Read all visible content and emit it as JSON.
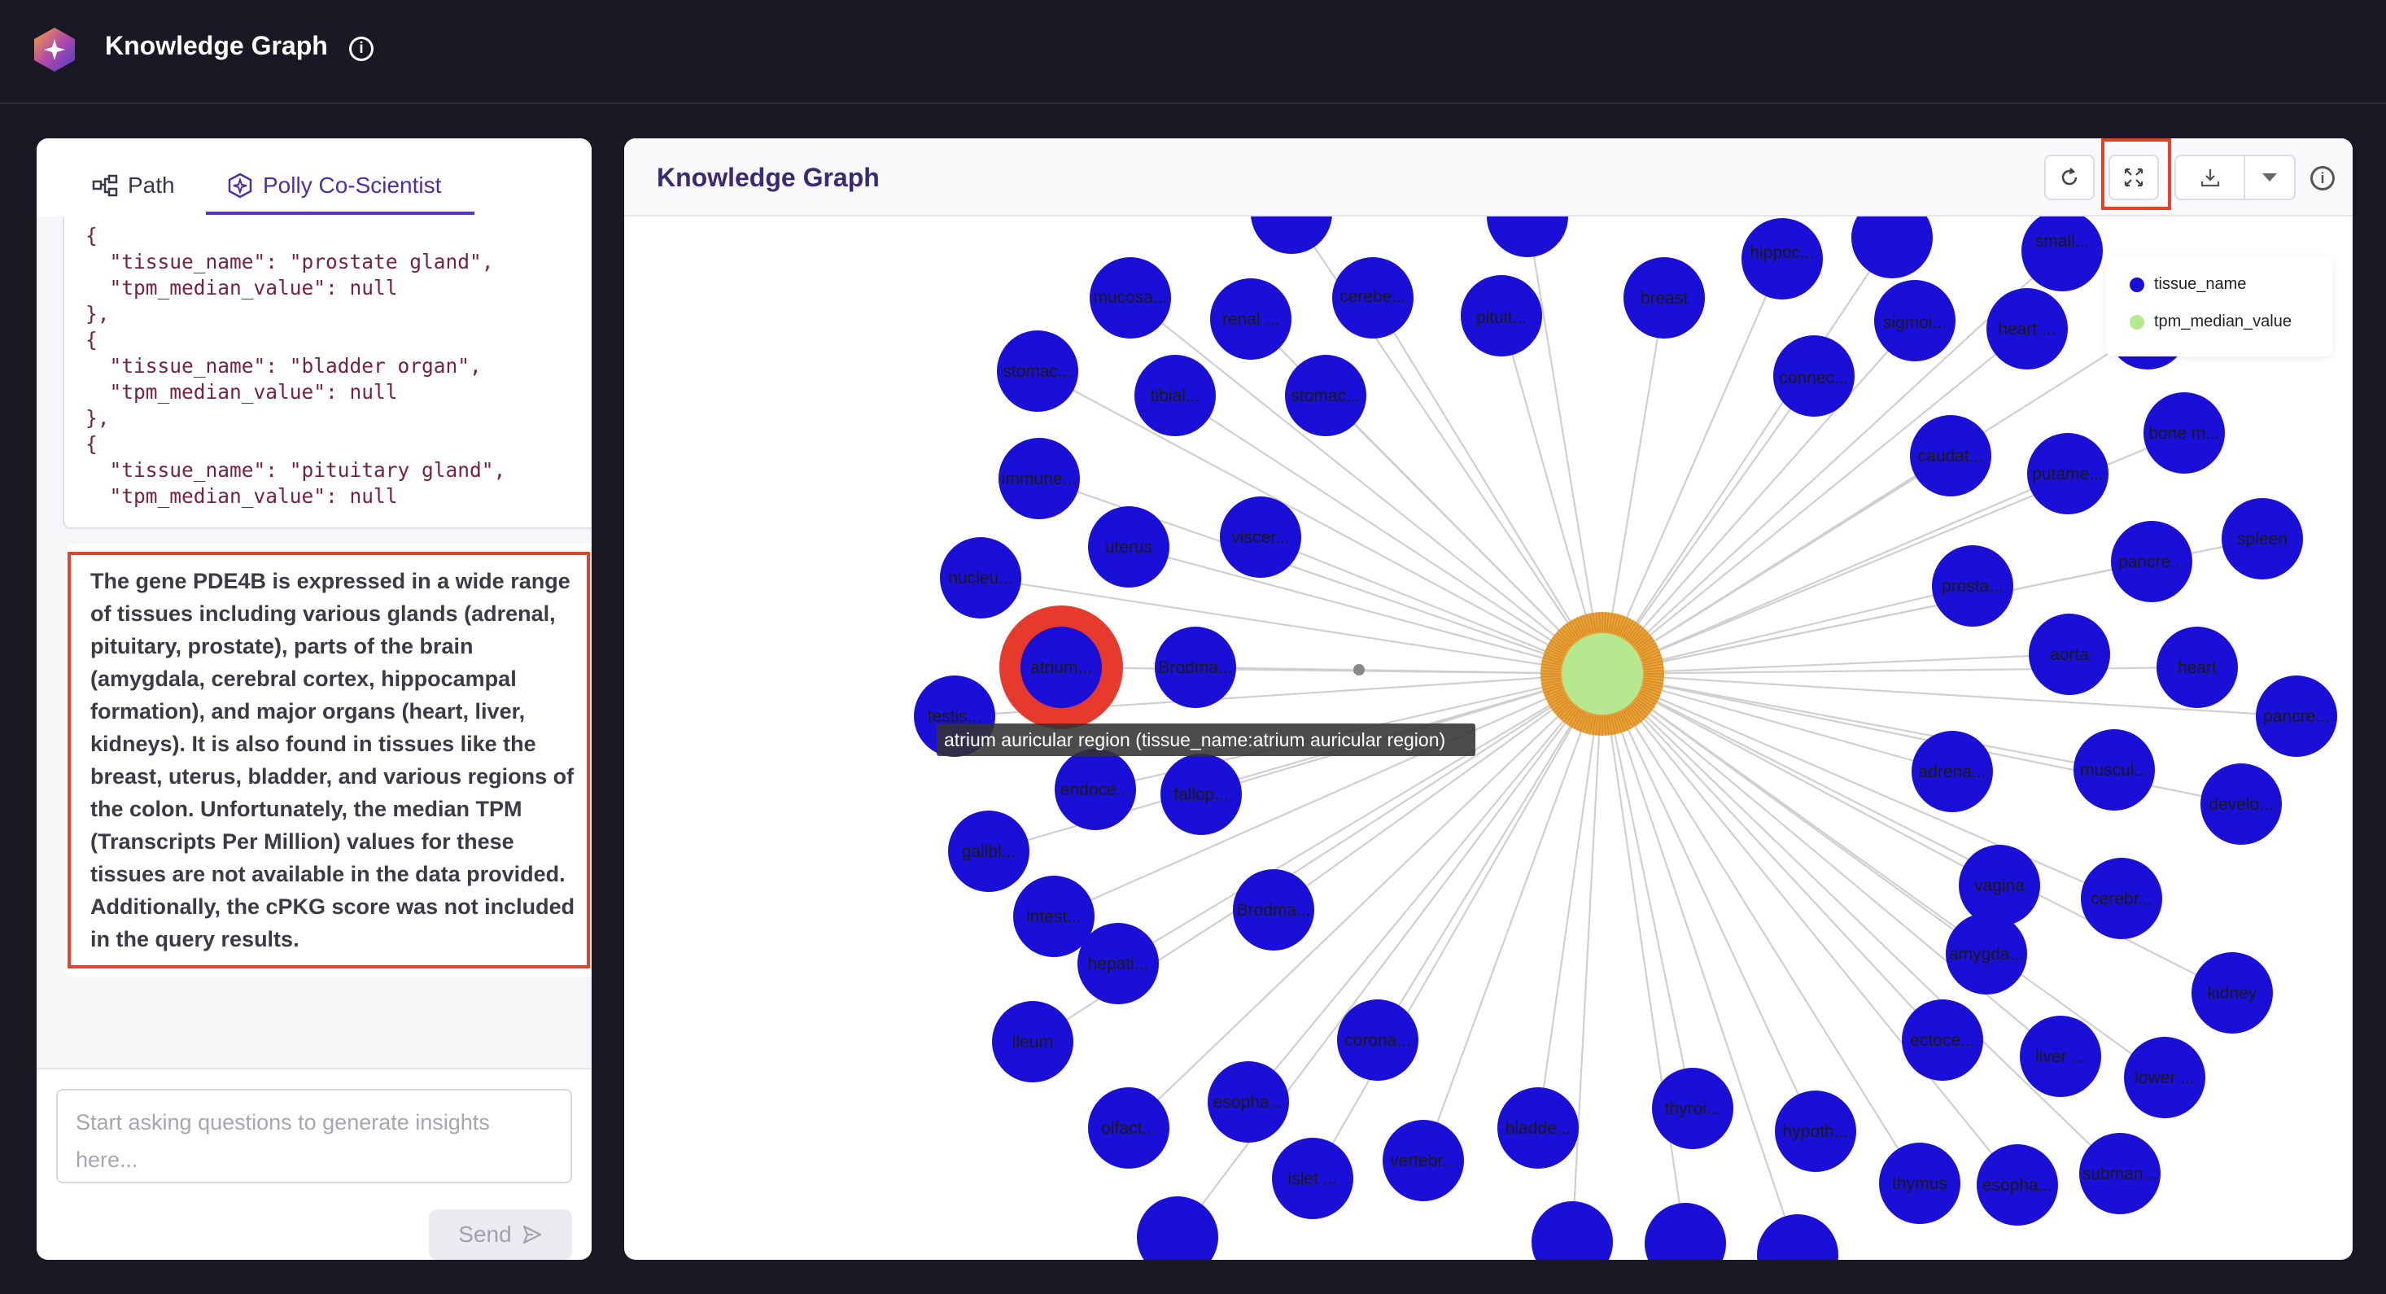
{
  "app": {
    "title": "Knowledge Graph"
  },
  "left": {
    "tabs": [
      {
        "label": "Path"
      },
      {
        "label": "Polly Co-Scientist"
      }
    ],
    "code_lines": [
      "{",
      "  \"tissue_name\": \"prostate gland\",",
      "  \"tpm_median_value\": null",
      "},",
      "{",
      "  \"tissue_name\": \"bladder organ\",",
      "  \"tpm_median_value\": null",
      "},",
      "{",
      "  \"tissue_name\": \"pituitary gland\",",
      "  \"tpm_median_value\": null"
    ],
    "answer": "The gene PDE4B is expressed in a wide range of tissues including various glands (adrenal, pituitary, prostate), parts of the brain (amygdala, cerebral cortex, hippocampal formation), and major organs (heart, liver, kidneys). It is also found in tissues like the breast, uterus, bladder, and various regions of the colon. Unfortunately, the median TPM (Transcripts Per Million) values for these tissues are not available in the data provided. Additionally, the cPKG score was not included in the query results.",
    "input_placeholder": "Start asking questions to generate insights here...",
    "send_label": "Send"
  },
  "graph": {
    "title": "Knowledge Graph",
    "legend": [
      {
        "label": "tissue_name",
        "color": "#1a0fd6"
      },
      {
        "label": "tpm_median_value",
        "color": "#b6e88f"
      }
    ],
    "colors": {
      "node": "#1a0fd6",
      "center": "#b6e88f",
      "center_ring": "#e8a23a",
      "selected_ring": "#e53a2c",
      "edge": "#cfcfcf"
    },
    "tooltip": "atrium auricular region (tissue_name:atrium auricular region)",
    "center_node": "tpm_median_value",
    "selected_node": "atrium...",
    "nodes": [
      {
        "label": ""
      },
      {
        "label": ""
      },
      {
        "label": "hippoc..."
      },
      {
        "label": ""
      },
      {
        "label": "small..."
      },
      {
        "label": "mucosa..."
      },
      {
        "label": "renal ..."
      },
      {
        "label": "cerebe..."
      },
      {
        "label": "pituit..."
      },
      {
        "label": "breast"
      },
      {
        "label": "sigmoi..."
      },
      {
        "label": "heart ..."
      },
      {
        "label": ""
      },
      {
        "label": "stomac..."
      },
      {
        "label": "tibial..."
      },
      {
        "label": "stomac..."
      },
      {
        "label": "connec..."
      },
      {
        "label": "caudat..."
      },
      {
        "label": "bone m..."
      },
      {
        "label": "putame..."
      },
      {
        "label": "immune..."
      },
      {
        "label": "uterus"
      },
      {
        "label": "viscer..."
      },
      {
        "label": "spleen"
      },
      {
        "label": "nucleu..."
      },
      {
        "label": "pancre..."
      },
      {
        "label": "prosta..."
      },
      {
        "label": "atrium..."
      },
      {
        "label": "Brodma..."
      },
      {
        "label": "aorta"
      },
      {
        "label": "heart"
      },
      {
        "label": "testis..."
      },
      {
        "label": "pancre..."
      },
      {
        "label": "endoce..."
      },
      {
        "label": "fallop..."
      },
      {
        "label": "adrena..."
      },
      {
        "label": "muscul..."
      },
      {
        "label": "develo..."
      },
      {
        "label": "gallbl..."
      },
      {
        "label": "intest..."
      },
      {
        "label": "Brodma..."
      },
      {
        "label": "vagina"
      },
      {
        "label": "cerebr..."
      },
      {
        "label": "hepati..."
      },
      {
        "label": "amygda..."
      },
      {
        "label": "kidney"
      },
      {
        "label": "ectoce..."
      },
      {
        "label": "ileum"
      },
      {
        "label": "corona..."
      },
      {
        "label": "liver ..."
      },
      {
        "label": "lower ..."
      },
      {
        "label": "esopha..."
      },
      {
        "label": "thyroi..."
      },
      {
        "label": "bladde..."
      },
      {
        "label": "olfact..."
      },
      {
        "label": "hypoth..."
      },
      {
        "label": "vertebr..."
      },
      {
        "label": "islet ..."
      },
      {
        "label": "thymus"
      },
      {
        "label": "esopha..."
      },
      {
        "label": "subman..."
      },
      {
        "label": ""
      },
      {
        "label": ""
      },
      {
        "label": ""
      },
      {
        "label": ""
      }
    ]
  }
}
